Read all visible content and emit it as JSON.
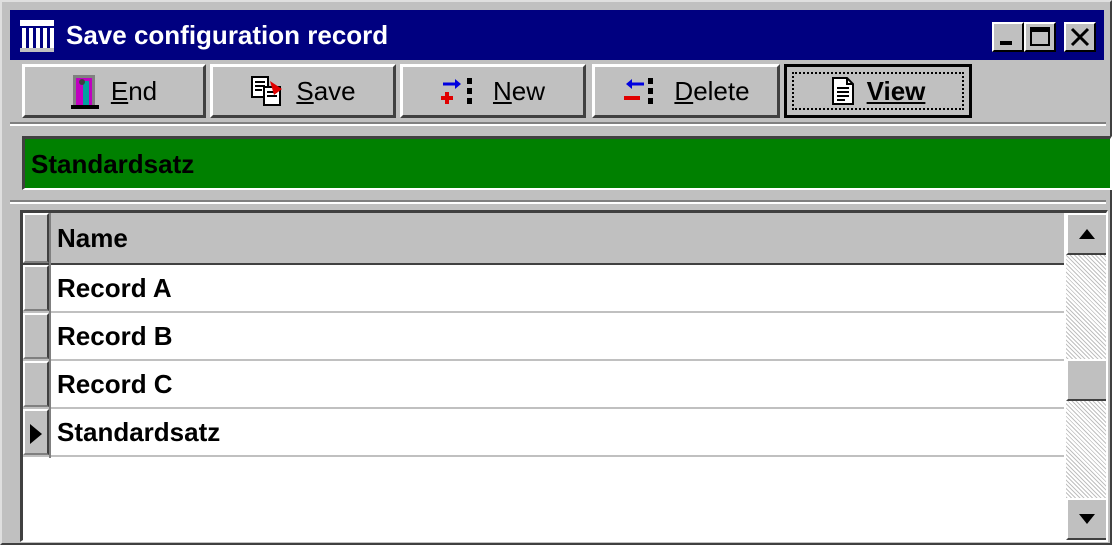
{
  "window": {
    "title": "Save configuration record",
    "controls": [
      "minimize-icon",
      "maximize-icon",
      "close-icon"
    ]
  },
  "toolbar": {
    "buttons": [
      {
        "key": "E",
        "rest": "nd",
        "icon": "door-exit-icon"
      },
      {
        "key": "S",
        "rest": "ave",
        "icon": "save-record-icon"
      },
      {
        "key": "N",
        "rest": "ew",
        "icon": "insert-record-icon"
      },
      {
        "key": "D",
        "rest": "elete",
        "icon": "delete-record-icon"
      },
      {
        "label": "View",
        "icon": "document-icon",
        "default": true
      }
    ]
  },
  "current_record": {
    "value": "Standardsatz",
    "color": "#008000"
  },
  "grid": {
    "column_header": "Name",
    "rows": [
      "Record A",
      "Record B",
      "Record C",
      "Standardsatz"
    ],
    "current_row_marker_index": 3
  },
  "colors": {
    "titlebar": "#000080",
    "face": "#c0c0c0"
  }
}
